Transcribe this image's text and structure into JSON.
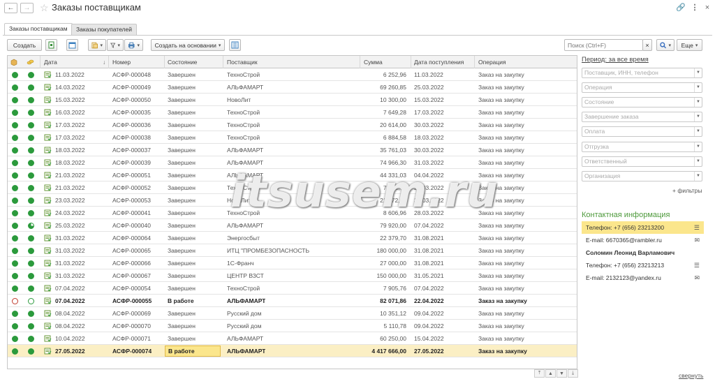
{
  "window": {
    "title": "Заказы поставщикам"
  },
  "tabs": [
    {
      "label": "Заказы поставщикам",
      "active": true
    },
    {
      "label": "Заказы покупателей",
      "active": false
    }
  ],
  "toolbar": {
    "create_label": "Создать",
    "create_based_label": "Создать на основании",
    "search_placeholder": "Поиск (Ctrl+F)",
    "search_clear": "×",
    "more_label": "Еще"
  },
  "table": {
    "columns": [
      "",
      "",
      "Дата",
      "Номер",
      "Состояние",
      "Поставщик",
      "Сумма",
      "Дата поступления",
      "Операция"
    ],
    "rows": [
      {
        "status": "green",
        "pay": "green",
        "date": "11.03.2022",
        "number": "АСФР-000048",
        "state": "Завершен",
        "supplier": "ТехноСтрой",
        "sum": "6 252,96",
        "arrival": "11.03.2022",
        "op": "Заказ на закупку"
      },
      {
        "status": "green",
        "pay": "green",
        "date": "14.03.2022",
        "number": "АСФР-000049",
        "state": "Завершен",
        "supplier": "АЛЬФАМАРТ",
        "sum": "69 260,85",
        "arrival": "25.03.2022",
        "op": "Заказ на закупку"
      },
      {
        "status": "green",
        "pay": "green",
        "date": "15.03.2022",
        "number": "АСФР-000050",
        "state": "Завершен",
        "supplier": "НовоЛит",
        "sum": "10 300,00",
        "arrival": "15.03.2022",
        "op": "Заказ на закупку"
      },
      {
        "status": "green",
        "pay": "green",
        "date": "16.03.2022",
        "number": "АСФР-000035",
        "state": "Завершен",
        "supplier": "ТехноСтрой",
        "sum": "7 649,28",
        "arrival": "17.03.2022",
        "op": "Заказ на закупку"
      },
      {
        "status": "green",
        "pay": "green",
        "date": "17.03.2022",
        "number": "АСФР-000036",
        "state": "Завершен",
        "supplier": "ТехноСтрой",
        "sum": "20 614,00",
        "arrival": "30.03.2022",
        "op": "Заказ на закупку"
      },
      {
        "status": "green",
        "pay": "green",
        "date": "17.03.2022",
        "number": "АСФР-000038",
        "state": "Завершен",
        "supplier": "ТехноСтрой",
        "sum": "6 884,58",
        "arrival": "18.03.2022",
        "op": "Заказ на закупку"
      },
      {
        "status": "green",
        "pay": "green",
        "date": "18.03.2022",
        "number": "АСФР-000037",
        "state": "Завершен",
        "supplier": "АЛЬФАМАРТ",
        "sum": "35 761,03",
        "arrival": "30.03.2022",
        "op": "Заказ на закупку"
      },
      {
        "status": "green",
        "pay": "green",
        "date": "18.03.2022",
        "number": "АСФР-000039",
        "state": "Завершен",
        "supplier": "АЛЬФАМАРТ",
        "sum": "74 966,30",
        "arrival": "31.03.2022",
        "op": "Заказ на закупку"
      },
      {
        "status": "green",
        "pay": "green",
        "date": "21.03.2022",
        "number": "АСФР-000051",
        "state": "Завершен",
        "supplier": "АЛЬФАМАРТ",
        "sum": "44 331,03",
        "arrival": "04.04.2022",
        "op": "Заказ на закупку"
      },
      {
        "status": "green",
        "pay": "green",
        "date": "21.03.2022",
        "number": "АСФР-000052",
        "state": "Завершен",
        "supplier": "ТехноСтрой",
        "sum": "7 781,74",
        "arrival": "21.03.2022",
        "op": "Заказ на закупку"
      },
      {
        "status": "green",
        "pay": "green",
        "date": "23.03.2022",
        "number": "АСФР-000053",
        "state": "Завершен",
        "supplier": "НовоЛит",
        "sum": "21 672,00",
        "arrival": "30.03.2022",
        "op": "Заказ на закупку"
      },
      {
        "status": "green",
        "pay": "green",
        "date": "24.03.2022",
        "number": "АСФР-000041",
        "state": "Завершен",
        "supplier": "ТехноСтрой",
        "sum": "8 606,96",
        "arrival": "28.03.2022",
        "op": "Заказ на закупку"
      },
      {
        "status": "green",
        "pay": "partial",
        "date": "25.03.2022",
        "number": "АСФР-000040",
        "state": "Завершен",
        "supplier": "АЛЬФАМАРТ",
        "sum": "79 920,00",
        "arrival": "07.04.2022",
        "op": "Заказ на закупку"
      },
      {
        "status": "green",
        "pay": "green",
        "date": "31.03.2022",
        "number": "АСФР-000064",
        "state": "Завершен",
        "supplier": "Энергосбыт",
        "sum": "22 379,70",
        "arrival": "31.08.2021",
        "op": "Заказ на закупку"
      },
      {
        "status": "green",
        "pay": "green",
        "date": "31.03.2022",
        "number": "АСФР-000065",
        "state": "Завершен",
        "supplier": "ИТЦ \"ПРОМБЕЗОПАСНОСТЬ",
        "sum": "180 000,00",
        "arrival": "31.08.2021",
        "op": "Заказ на закупку"
      },
      {
        "status": "green",
        "pay": "green",
        "date": "31.03.2022",
        "number": "АСФР-000066",
        "state": "Завершен",
        "supplier": "1С-Франч",
        "sum": "27 000,00",
        "arrival": "31.08.2021",
        "op": "Заказ на закупку"
      },
      {
        "status": "green",
        "pay": "green",
        "date": "31.03.2022",
        "number": "АСФР-000067",
        "state": "Завершен",
        "supplier": "ЦЕНТР ВЗСТ",
        "sum": "150 000,00",
        "arrival": "31.05.2021",
        "op": "Заказ на закупку"
      },
      {
        "status": "green",
        "pay": "green",
        "date": "07.04.2022",
        "number": "АСФР-000054",
        "state": "Завершен",
        "supplier": "ТехноСтрой",
        "sum": "7 905,76",
        "arrival": "07.04.2022",
        "op": "Заказ на закупку"
      },
      {
        "status": "red",
        "pay": "ring",
        "date": "07.04.2022",
        "number": "АСФР-000055",
        "state": "В работе",
        "supplier": "АЛЬФАМАРТ",
        "sum": "82 071,86",
        "arrival": "22.04.2022",
        "op": "Заказ на закупку",
        "bold": true
      },
      {
        "status": "green",
        "pay": "green",
        "date": "08.04.2022",
        "number": "АСФР-000069",
        "state": "Завершен",
        "supplier": "Русский дом",
        "sum": "10 351,12",
        "arrival": "09.04.2022",
        "op": "Заказ на закупку"
      },
      {
        "status": "green",
        "pay": "green",
        "date": "08.04.2022",
        "number": "АСФР-000070",
        "state": "Завершен",
        "supplier": "Русский дом",
        "sum": "5 110,78",
        "arrival": "09.04.2022",
        "op": "Заказ на закупку"
      },
      {
        "status": "green",
        "pay": "green",
        "date": "10.04.2022",
        "number": "АСФР-000071",
        "state": "Завершен",
        "supplier": "АЛЬФАМАРТ",
        "sum": "60 250,00",
        "arrival": "15.04.2022",
        "op": "Заказ на закупку"
      },
      {
        "status": "green",
        "pay": "green",
        "date": "27.05.2022",
        "number": "АСФР-000074",
        "state": "В работе",
        "supplier": "АЛЬФАМАРТ",
        "sum": "4 417 666,00",
        "arrival": "27.05.2022",
        "op": "Заказ на закупку",
        "bold": true,
        "selected": true
      }
    ]
  },
  "filters": {
    "period_label": "Период: за все время",
    "fields": [
      "Поставщик, ИНН, телефон",
      "Операция",
      "Состояние",
      "Завершение заказа",
      "Оплата",
      "Отгрузка",
      "Ответственный",
      "Организация"
    ],
    "add_filters": "+ фильтры"
  },
  "contacts": {
    "header": "Контактная информация",
    "items": [
      {
        "text": "Телефон: +7 (656) 23213200",
        "icon": "menu-icon",
        "highlight": true
      },
      {
        "text": "E-mail: 6670365@rambler.ru",
        "icon": "mail-icon"
      },
      {
        "text": "Соломин Леонид Варламович",
        "bold": true
      },
      {
        "text": "Телефон: +7 (656) 23213213",
        "icon": "menu-icon"
      },
      {
        "text": "E-mail: 2132123@yandex.ru",
        "icon": "mail-icon"
      }
    ],
    "collapse": "свернуть"
  },
  "watermark": "itsusem.ru",
  "colors": {
    "green": "#2b9a3c",
    "red": "#c0392b",
    "selected_row": "#fbefc4",
    "contact_highlight": "#fbe68c",
    "contact_header": "#4e9a3c"
  }
}
